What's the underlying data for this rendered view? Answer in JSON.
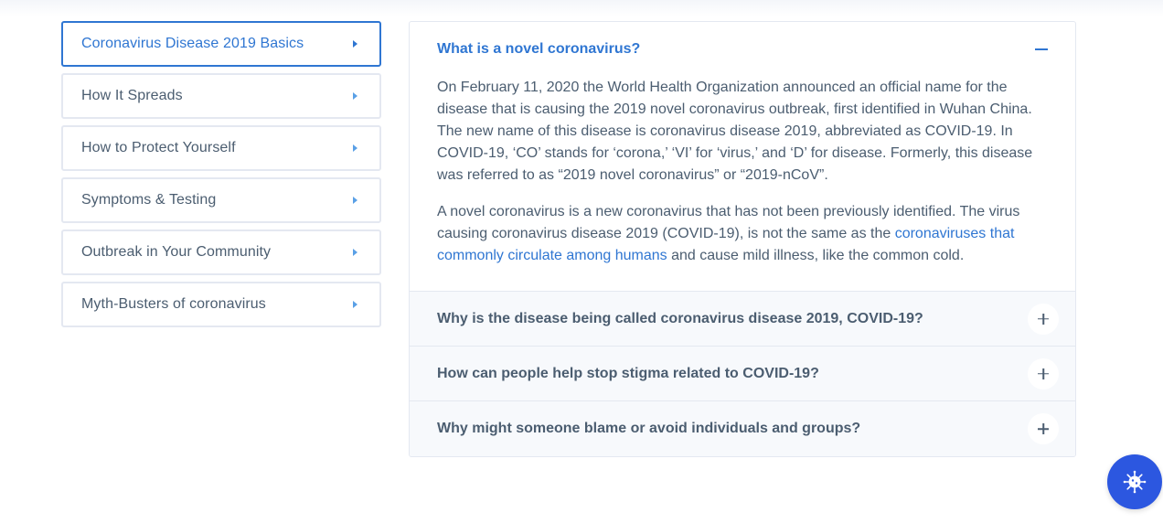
{
  "sidebar": {
    "items": [
      {
        "label": "Coronavirus Disease 2019 Basics",
        "active": true
      },
      {
        "label": "How It Spreads"
      },
      {
        "label": "How to Protect Yourself"
      },
      {
        "label": "Symptoms & Testing"
      },
      {
        "label": "Outbreak in Your Community"
      },
      {
        "label": "Myth-Busters of coronavirus"
      }
    ]
  },
  "accordion": {
    "open": {
      "title": "What is a novel coronavirus?",
      "p1": "On February 11, 2020 the World Health Organization announced an official name for the disease that is causing the 2019 novel coronavirus outbreak, first identified in Wuhan China. The new name of this disease is coronavirus disease 2019, abbreviated as COVID-19. In COVID-19, ‘CO’ stands for ‘corona,’ ‘VI’ for ‘virus,’ and ‘D’ for disease. Formerly, this disease was referred to as “2019 novel coronavirus” or “2019-nCoV”.",
      "p2_before": "A novel coronavirus is a new coronavirus that has not been previously identified. The virus causing coronavirus disease 2019 (COVID-19), is not the same as the ",
      "p2_link": "coronaviruses that commonly circulate among humans",
      "p2_after": " and cause mild illness, like the common cold."
    },
    "items": [
      {
        "question": "Why is the disease being called coronavirus disease 2019, COVID-19?"
      },
      {
        "question": "How can people help stop stigma related to COVID-19?"
      },
      {
        "question": "Why might someone blame or avoid individuals and groups?"
      }
    ]
  },
  "fab": {
    "icon": "virus-icon"
  },
  "colors": {
    "accent": "#2f76d2",
    "fab": "#2c57e0",
    "border": "#e4e8f1"
  }
}
